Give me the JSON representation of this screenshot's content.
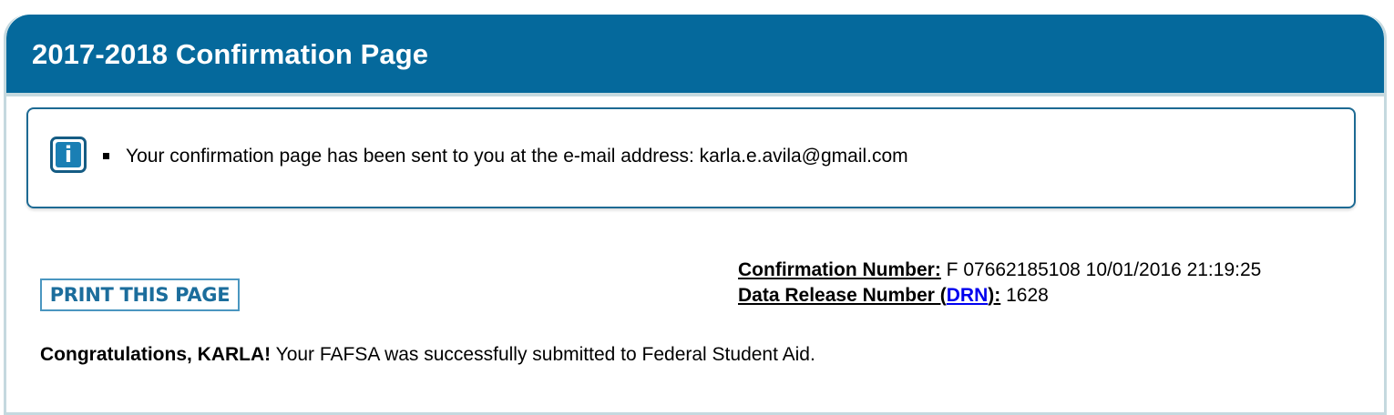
{
  "header": {
    "title": "2017-2018 Confirmation Page"
  },
  "info_box": {
    "icon": "info-icon",
    "icon_glyph": "i",
    "message": "Your confirmation page has been sent to you at the e-mail address: karla.e.avila@gmail.com"
  },
  "print_button": {
    "label": "PRINT THIS PAGE"
  },
  "confirmation": {
    "number_label": "Confirmation Number:",
    "number_value": "F 07662185108 10/01/2016 21:19:25",
    "drn_label_prefix": "Data Release Number (",
    "drn_link": "DRN",
    "drn_label_suffix": "):",
    "drn_value": "1628"
  },
  "congrats": {
    "bold_text": "Congratulations, KARLA!",
    "message": " Your FAFSA was successfully submitted to Federal Student Aid."
  },
  "colors": {
    "header_bg": "#05699c",
    "border": "#c5d9df",
    "link": "#0000ee"
  }
}
